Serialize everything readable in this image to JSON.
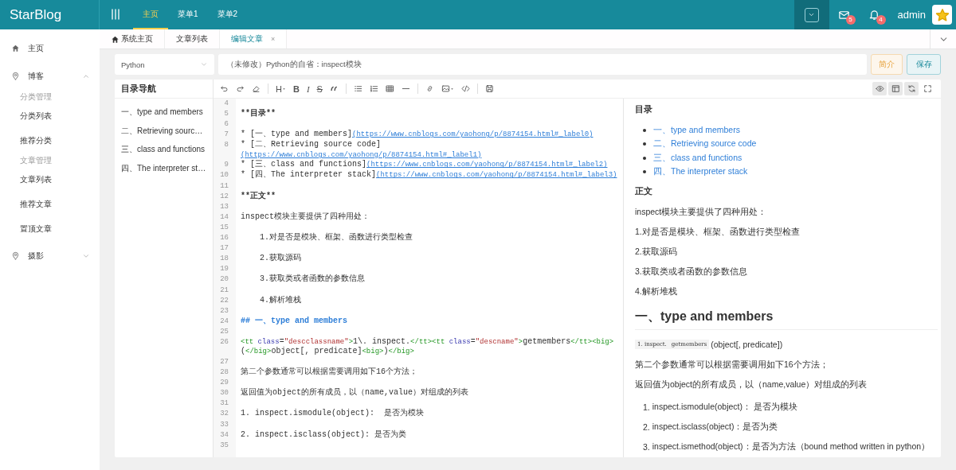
{
  "header": {
    "logo": "StarBlog",
    "nav": [
      {
        "label": "主页",
        "selected": true
      },
      {
        "label": "菜单1",
        "selected": false
      },
      {
        "label": "菜单2",
        "selected": false
      }
    ],
    "mail_count": "5",
    "notice_count": "4",
    "user": "admin"
  },
  "sidebar": {
    "items": [
      {
        "kind": "link",
        "label": "主页"
      },
      {
        "kind": "menu",
        "label": "博客",
        "expanded": true,
        "children": [
          {
            "kind": "group",
            "label": "分类管理"
          },
          {
            "kind": "link",
            "label": "分类列表"
          },
          {
            "kind": "link",
            "label": "推荐分类"
          },
          {
            "kind": "group",
            "label": "文章管理"
          },
          {
            "kind": "link",
            "label": "文章列表"
          },
          {
            "kind": "link",
            "label": "推荐文章"
          },
          {
            "kind": "link",
            "label": "置顶文章"
          }
        ]
      },
      {
        "kind": "menu",
        "label": "摄影",
        "expanded": false
      }
    ]
  },
  "tabs": [
    {
      "label": "系统主页",
      "kind": "home",
      "selected": false
    },
    {
      "label": "文章列表",
      "kind": "plain",
      "selected": false
    },
    {
      "label": "编辑文章",
      "kind": "closable",
      "selected": true,
      "close": "×"
    }
  ],
  "form": {
    "category": "Python",
    "title": "（未修改）Python的自省：inspect模块",
    "buttons": [
      {
        "label": "简介",
        "kind": "warning"
      },
      {
        "label": "保存",
        "kind": "primary"
      }
    ]
  },
  "toc": {
    "title": "目录导航",
    "items": [
      "一、type and members",
      "二、Retrieving sourc…",
      "三、class and functions",
      "四、The interpreter st…"
    ]
  },
  "toolbar": [
    {
      "kind": "undo"
    },
    {
      "kind": "redo"
    },
    {
      "kind": "eraser"
    },
    {
      "kind": "sep"
    },
    {
      "kind": "heading",
      "label": "H"
    },
    {
      "kind": "bold",
      "label": "B"
    },
    {
      "kind": "italic",
      "label": "I"
    },
    {
      "kind": "strike",
      "label": "S"
    },
    {
      "kind": "quote"
    },
    {
      "kind": "sep"
    },
    {
      "kind": "ul"
    },
    {
      "kind": "ol"
    },
    {
      "kind": "table"
    },
    {
      "kind": "hr"
    },
    {
      "kind": "sep"
    },
    {
      "kind": "link"
    },
    {
      "kind": "image"
    },
    {
      "kind": "code"
    },
    {
      "kind": "sep"
    },
    {
      "kind": "save"
    }
  ],
  "view_buttons": [
    {
      "kind": "eye",
      "on": true
    },
    {
      "kind": "layout",
      "on": true
    },
    {
      "kind": "sync",
      "on": true
    },
    {
      "kind": "fullscreen",
      "on": false
    }
  ],
  "code": [
    {
      "number": "4"
    },
    {
      "number": "5",
      "segments": [
        {
          "kind": "strong",
          "text": "**目录**"
        }
      ]
    },
    {
      "number": "6"
    },
    {
      "number": "7",
      "segments": [
        {
          "kind": "text",
          "text": "* [一、type and members]"
        },
        {
          "kind": "url",
          "text": "(https://www.cnblogs.com/yaohong/p/8874154.html#_label0)"
        }
      ]
    },
    {
      "number": "8",
      "segments": [
        {
          "kind": "text",
          "text": "* [二、Retrieving source code]"
        },
        {
          "kind": "url",
          "text": "(https://www.cnblogs.com/yaohong/p/8874154.html#_label1)"
        }
      ]
    },
    {
      "number": "9",
      "segments": [
        {
          "kind": "text",
          "text": "* [三、class and functions]"
        },
        {
          "kind": "url",
          "text": "(https://www.cnblogs.com/yaohong/p/8874154.html#_label2)"
        }
      ]
    },
    {
      "number": "10",
      "segments": [
        {
          "kind": "text",
          "text": "* [四、The interpreter stack]"
        },
        {
          "kind": "url",
          "text": "(https://www.cnblogs.com/yaohong/p/8874154.html#_label3)"
        }
      ]
    },
    {
      "number": "11"
    },
    {
      "number": "12",
      "segments": [
        {
          "kind": "strong",
          "text": "**正文**"
        }
      ]
    },
    {
      "number": "13"
    },
    {
      "number": "14",
      "segments": [
        {
          "kind": "text",
          "text": "inspect模块主要提供了四种用处："
        }
      ]
    },
    {
      "number": "15"
    },
    {
      "number": "16",
      "segments": [
        {
          "kind": "text",
          "text": "    1.对是否是模块、框架、函数进行类型检查"
        }
      ]
    },
    {
      "number": "17"
    },
    {
      "number": "18",
      "segments": [
        {
          "kind": "text",
          "text": "    2.获取源码"
        }
      ]
    },
    {
      "number": "19"
    },
    {
      "number": "20",
      "segments": [
        {
          "kind": "text",
          "text": "    3.获取类或者函数的参数信息"
        }
      ]
    },
    {
      "number": "21"
    },
    {
      "number": "22",
      "segments": [
        {
          "kind": "text",
          "text": "    4.解析堆栈"
        }
      ]
    },
    {
      "number": "23"
    },
    {
      "number": "24",
      "segments": [
        {
          "kind": "heading",
          "text": "## 一、type and members"
        }
      ]
    },
    {
      "number": "25"
    },
    {
      "number": "26",
      "segments": [
        {
          "kind": "tag",
          "text": "<tt "
        },
        {
          "kind": "attr",
          "text": "class"
        },
        {
          "kind": "text",
          "text": "="
        },
        {
          "kind": "string",
          "text": "\"descclassname\""
        },
        {
          "kind": "tag",
          "text": ">"
        },
        {
          "kind": "text",
          "text": "1\\. inspect."
        },
        {
          "kind": "tag",
          "text": "</tt><tt "
        },
        {
          "kind": "attr",
          "text": "class"
        },
        {
          "kind": "text",
          "text": "="
        },
        {
          "kind": "string",
          "text": "\"descname\""
        },
        {
          "kind": "tag",
          "text": ">"
        },
        {
          "kind": "text",
          "text": "getmembers"
        },
        {
          "kind": "tag",
          "text": "</tt><big>"
        },
        {
          "kind": "text",
          "text": "("
        },
        {
          "kind": "tag",
          "text": "</big>"
        },
        {
          "kind": "text",
          "text": "object[, predicate]"
        },
        {
          "kind": "tag",
          "text": "<big>"
        },
        {
          "kind": "text",
          "text": ")"
        },
        {
          "kind": "tag",
          "text": "</big>"
        }
      ]
    },
    {
      "number": "27"
    },
    {
      "number": "28",
      "segments": [
        {
          "kind": "text",
          "text": "第二个参数通常可以根据需要调用如下16个方法；"
        }
      ]
    },
    {
      "number": "29"
    },
    {
      "number": "30",
      "segments": [
        {
          "kind": "text",
          "text": "返回值为object的所有成员，以（name,value）对组成的列表"
        }
      ]
    },
    {
      "number": "31"
    },
    {
      "number": "32",
      "segments": [
        {
          "kind": "text",
          "text": "1. inspect.ismodule(object):  是否为模块"
        }
      ]
    },
    {
      "number": "33"
    },
    {
      "number": "34",
      "segments": [
        {
          "kind": "text",
          "text": "2. inspect.isclass(object): 是否为类"
        }
      ]
    },
    {
      "number": "35"
    }
  ],
  "preview": [
    {
      "kind": "title",
      "text": "目录"
    },
    {
      "kind": "links",
      "items": [
        "一、type and members",
        "二、Retrieving source code",
        "三、class and functions",
        "四、The interpreter stack"
      ]
    },
    {
      "kind": "title",
      "text": "正文"
    },
    {
      "kind": "p",
      "text": "inspect模块主要提供了四种用处："
    },
    {
      "kind": "p",
      "text": "1.对是否是模块、框架、函数进行类型检查"
    },
    {
      "kind": "p",
      "text": "2.获取源码"
    },
    {
      "kind": "p",
      "text": "3.获取类或者函数的参数信息"
    },
    {
      "kind": "p",
      "text": "4.解析堆栈"
    },
    {
      "kind": "h2",
      "text": "一、type and members"
    },
    {
      "kind": "signature",
      "code": [
        "1. inspect.",
        "getmembers"
      ],
      "text": "(object[, predicate])"
    },
    {
      "kind": "p",
      "text": "第二个参数通常可以根据需要调用如下16个方法；"
    },
    {
      "kind": "p",
      "text": "返回值为object的所有成员，以（name,value）对组成的列表"
    },
    {
      "kind": "item",
      "number": "1.",
      "text": "inspect.ismodule(object)：  是否为模块"
    },
    {
      "kind": "item",
      "number": "2.",
      "text": "inspect.isclass(object)：是否为类"
    },
    {
      "kind": "item",
      "number": "3.",
      "text": "inspect.ismethod(object)：是否为方法（bound method written in python）"
    }
  ]
}
